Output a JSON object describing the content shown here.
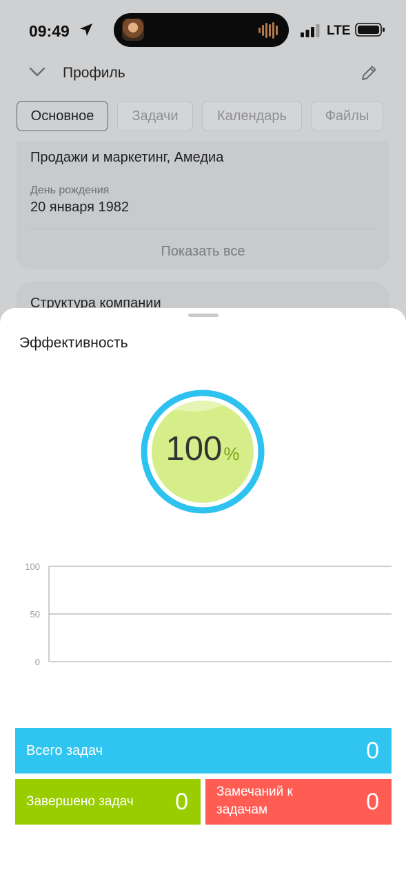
{
  "status_bar": {
    "time": "09:49",
    "network": "LTE",
    "icons": [
      "location-arrow-icon",
      "signal-icon",
      "battery-icon"
    ]
  },
  "header": {
    "title": "Профиль",
    "icons": [
      "chevron-down-icon",
      "pencil-icon"
    ]
  },
  "tabs": [
    {
      "label": "Основное",
      "active": true
    },
    {
      "label": "Задачи",
      "active": false
    },
    {
      "label": "Календарь",
      "active": false
    },
    {
      "label": "Файлы",
      "active": false
    }
  ],
  "profile_card": {
    "department": "Продажи и маркетинг, Амедиа",
    "birthday_label": "День рождения",
    "birthday_value": "20 января 1982",
    "show_all": "Показать все"
  },
  "structure_card": {
    "title": "Структура компании"
  },
  "sheet": {
    "title": "Эффективность",
    "gauge": {
      "value": "100",
      "unit": "%",
      "ring_color": "#2ec2f0",
      "fill_color": "#d6ee8a"
    },
    "stats": {
      "total_label": "Всего задач",
      "total_value": "0",
      "done_label": "Завершено задач",
      "done_value": "0",
      "notes_label_1": "Замечаний к",
      "notes_label_2": "задачам",
      "notes_value": "0",
      "colors": {
        "total": "#30c4f0",
        "done": "#99cd00",
        "notes": "#ff5d54"
      }
    }
  },
  "chart_data": {
    "type": "line",
    "title": "",
    "xlabel": "",
    "ylabel": "",
    "ylim": [
      0,
      100
    ],
    "yticks": [
      "100",
      "50",
      "0"
    ],
    "series": [],
    "grid": true
  }
}
